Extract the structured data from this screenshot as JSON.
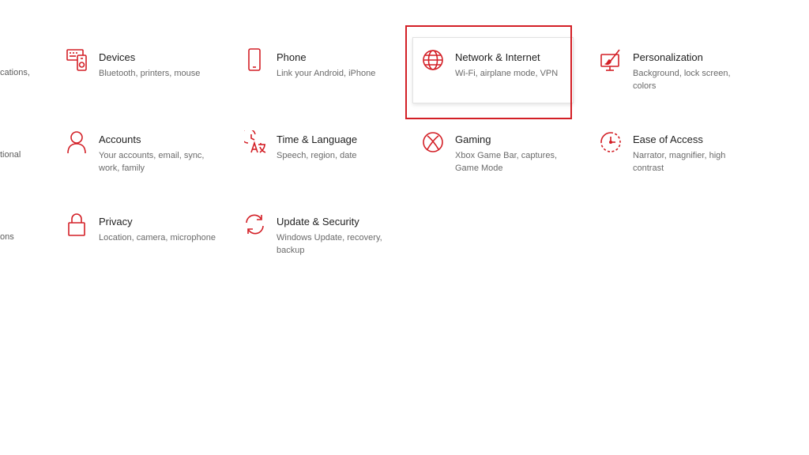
{
  "accent_color": "#d31f26",
  "left_fragments": [
    "cations,",
    "tional",
    "ons"
  ],
  "tiles": [
    {
      "title": "Devices",
      "desc": "Bluetooth, printers, mouse",
      "icon": "devices-icon"
    },
    {
      "title": "Phone",
      "desc": "Link your Android, iPhone",
      "icon": "phone-icon"
    },
    {
      "title": "Network & Internet",
      "desc": "Wi-Fi, airplane mode, VPN",
      "icon": "globe-icon"
    },
    {
      "title": "Personalization",
      "desc": "Background, lock screen, colors",
      "icon": "paintbrush-icon"
    },
    {
      "title": "Accounts",
      "desc": "Your accounts, email, sync, work, family",
      "icon": "person-icon"
    },
    {
      "title": "Time & Language",
      "desc": "Speech, region, date",
      "icon": "time-language-icon"
    },
    {
      "title": "Gaming",
      "desc": "Xbox Game Bar, captures, Game Mode",
      "icon": "xbox-icon"
    },
    {
      "title": "Ease of Access",
      "desc": "Narrator, magnifier, high contrast",
      "icon": "ease-of-access-icon"
    },
    {
      "title": "Privacy",
      "desc": "Location, camera, microphone",
      "icon": "lock-icon"
    },
    {
      "title": "Update & Security",
      "desc": "Windows Update, recovery, backup",
      "icon": "sync-icon"
    }
  ]
}
